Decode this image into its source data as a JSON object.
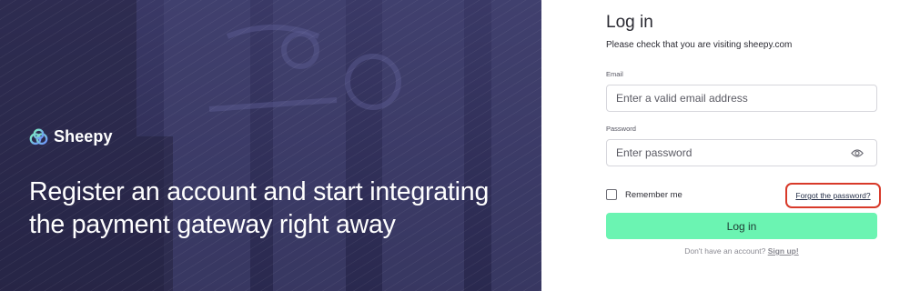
{
  "hero": {
    "brand_name": "Sheepy",
    "headline": "Register an account and start integrating the payment gateway right away"
  },
  "login": {
    "title": "Log in",
    "notice": "Please check that you are visiting sheepy.com",
    "email_label": "Email",
    "email_placeholder": "Enter a valid email address",
    "password_label": "Password",
    "password_placeholder": "Enter password",
    "remember_label": "Remember me",
    "forgot_link": "Forgot the password?",
    "submit_label": "Log in",
    "signup_prompt": "Don't have an account?",
    "signup_link": "Sign up!"
  },
  "colors": {
    "hero_bg": "#2f2e57",
    "primary_button": "#6bf4b2",
    "highlight_outline": "#d83a2a"
  },
  "icons": {
    "logo": "sheepy-logo-icon",
    "password_toggle": "eye-icon"
  }
}
